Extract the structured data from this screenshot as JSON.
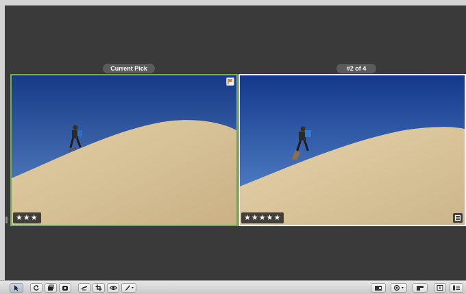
{
  "viewer": {
    "left_label": "Current Pick",
    "right_label": "#2 of 4"
  },
  "photos": [
    {
      "rating": "★★★",
      "flagged": true,
      "stack_badge": false
    },
    {
      "rating": "★★★★★",
      "flagged": false,
      "stack_badge": true
    }
  ],
  "colors": {
    "pick_border": "#6fb04a",
    "selected_border": "#f2f2f2",
    "viewer_bg": "#3a3a3a",
    "sky_top": "#1c3f8f",
    "sky_bottom": "#5a88c8",
    "sand": "#d8c39a"
  },
  "toolbar": {
    "left_tools": [
      "select-arrow-icon",
      "rotate-icon",
      "stack-icon",
      "stack-icon-alt",
      "straighten-icon",
      "crop-icon",
      "red-eye-icon",
      "brush-icon"
    ],
    "right_tools": [
      "viewer-mode-icon",
      "zoom-menu-icon",
      "adjust-icon",
      "single-view-icon",
      "info-view-icon"
    ]
  }
}
